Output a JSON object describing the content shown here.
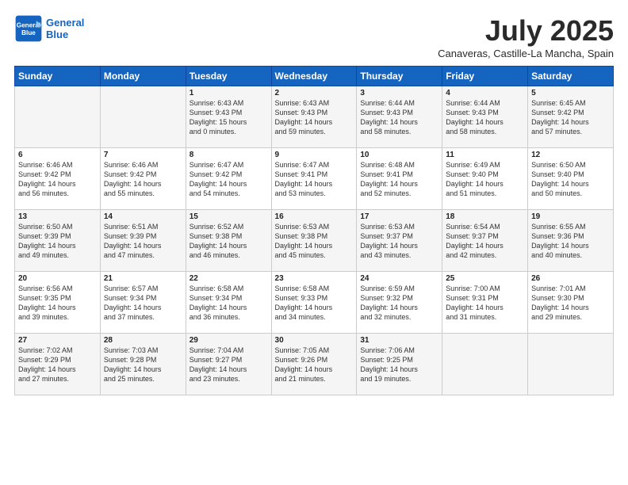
{
  "header": {
    "logo_line1": "General",
    "logo_line2": "Blue",
    "title": "July 2025",
    "subtitle": "Canaveras, Castille-La Mancha, Spain"
  },
  "weekdays": [
    "Sunday",
    "Monday",
    "Tuesday",
    "Wednesday",
    "Thursday",
    "Friday",
    "Saturday"
  ],
  "weeks": [
    [
      {
        "day": "",
        "info": ""
      },
      {
        "day": "",
        "info": ""
      },
      {
        "day": "1",
        "info": "Sunrise: 6:43 AM\nSunset: 9:43 PM\nDaylight: 15 hours\nand 0 minutes."
      },
      {
        "day": "2",
        "info": "Sunrise: 6:43 AM\nSunset: 9:43 PM\nDaylight: 14 hours\nand 59 minutes."
      },
      {
        "day": "3",
        "info": "Sunrise: 6:44 AM\nSunset: 9:43 PM\nDaylight: 14 hours\nand 58 minutes."
      },
      {
        "day": "4",
        "info": "Sunrise: 6:44 AM\nSunset: 9:43 PM\nDaylight: 14 hours\nand 58 minutes."
      },
      {
        "day": "5",
        "info": "Sunrise: 6:45 AM\nSunset: 9:42 PM\nDaylight: 14 hours\nand 57 minutes."
      }
    ],
    [
      {
        "day": "6",
        "info": "Sunrise: 6:46 AM\nSunset: 9:42 PM\nDaylight: 14 hours\nand 56 minutes."
      },
      {
        "day": "7",
        "info": "Sunrise: 6:46 AM\nSunset: 9:42 PM\nDaylight: 14 hours\nand 55 minutes."
      },
      {
        "day": "8",
        "info": "Sunrise: 6:47 AM\nSunset: 9:42 PM\nDaylight: 14 hours\nand 54 minutes."
      },
      {
        "day": "9",
        "info": "Sunrise: 6:47 AM\nSunset: 9:41 PM\nDaylight: 14 hours\nand 53 minutes."
      },
      {
        "day": "10",
        "info": "Sunrise: 6:48 AM\nSunset: 9:41 PM\nDaylight: 14 hours\nand 52 minutes."
      },
      {
        "day": "11",
        "info": "Sunrise: 6:49 AM\nSunset: 9:40 PM\nDaylight: 14 hours\nand 51 minutes."
      },
      {
        "day": "12",
        "info": "Sunrise: 6:50 AM\nSunset: 9:40 PM\nDaylight: 14 hours\nand 50 minutes."
      }
    ],
    [
      {
        "day": "13",
        "info": "Sunrise: 6:50 AM\nSunset: 9:39 PM\nDaylight: 14 hours\nand 49 minutes."
      },
      {
        "day": "14",
        "info": "Sunrise: 6:51 AM\nSunset: 9:39 PM\nDaylight: 14 hours\nand 47 minutes."
      },
      {
        "day": "15",
        "info": "Sunrise: 6:52 AM\nSunset: 9:38 PM\nDaylight: 14 hours\nand 46 minutes."
      },
      {
        "day": "16",
        "info": "Sunrise: 6:53 AM\nSunset: 9:38 PM\nDaylight: 14 hours\nand 45 minutes."
      },
      {
        "day": "17",
        "info": "Sunrise: 6:53 AM\nSunset: 9:37 PM\nDaylight: 14 hours\nand 43 minutes."
      },
      {
        "day": "18",
        "info": "Sunrise: 6:54 AM\nSunset: 9:37 PM\nDaylight: 14 hours\nand 42 minutes."
      },
      {
        "day": "19",
        "info": "Sunrise: 6:55 AM\nSunset: 9:36 PM\nDaylight: 14 hours\nand 40 minutes."
      }
    ],
    [
      {
        "day": "20",
        "info": "Sunrise: 6:56 AM\nSunset: 9:35 PM\nDaylight: 14 hours\nand 39 minutes."
      },
      {
        "day": "21",
        "info": "Sunrise: 6:57 AM\nSunset: 9:34 PM\nDaylight: 14 hours\nand 37 minutes."
      },
      {
        "day": "22",
        "info": "Sunrise: 6:58 AM\nSunset: 9:34 PM\nDaylight: 14 hours\nand 36 minutes."
      },
      {
        "day": "23",
        "info": "Sunrise: 6:58 AM\nSunset: 9:33 PM\nDaylight: 14 hours\nand 34 minutes."
      },
      {
        "day": "24",
        "info": "Sunrise: 6:59 AM\nSunset: 9:32 PM\nDaylight: 14 hours\nand 32 minutes."
      },
      {
        "day": "25",
        "info": "Sunrise: 7:00 AM\nSunset: 9:31 PM\nDaylight: 14 hours\nand 31 minutes."
      },
      {
        "day": "26",
        "info": "Sunrise: 7:01 AM\nSunset: 9:30 PM\nDaylight: 14 hours\nand 29 minutes."
      }
    ],
    [
      {
        "day": "27",
        "info": "Sunrise: 7:02 AM\nSunset: 9:29 PM\nDaylight: 14 hours\nand 27 minutes."
      },
      {
        "day": "28",
        "info": "Sunrise: 7:03 AM\nSunset: 9:28 PM\nDaylight: 14 hours\nand 25 minutes."
      },
      {
        "day": "29",
        "info": "Sunrise: 7:04 AM\nSunset: 9:27 PM\nDaylight: 14 hours\nand 23 minutes."
      },
      {
        "day": "30",
        "info": "Sunrise: 7:05 AM\nSunset: 9:26 PM\nDaylight: 14 hours\nand 21 minutes."
      },
      {
        "day": "31",
        "info": "Sunrise: 7:06 AM\nSunset: 9:25 PM\nDaylight: 14 hours\nand 19 minutes."
      },
      {
        "day": "",
        "info": ""
      },
      {
        "day": "",
        "info": ""
      }
    ]
  ]
}
